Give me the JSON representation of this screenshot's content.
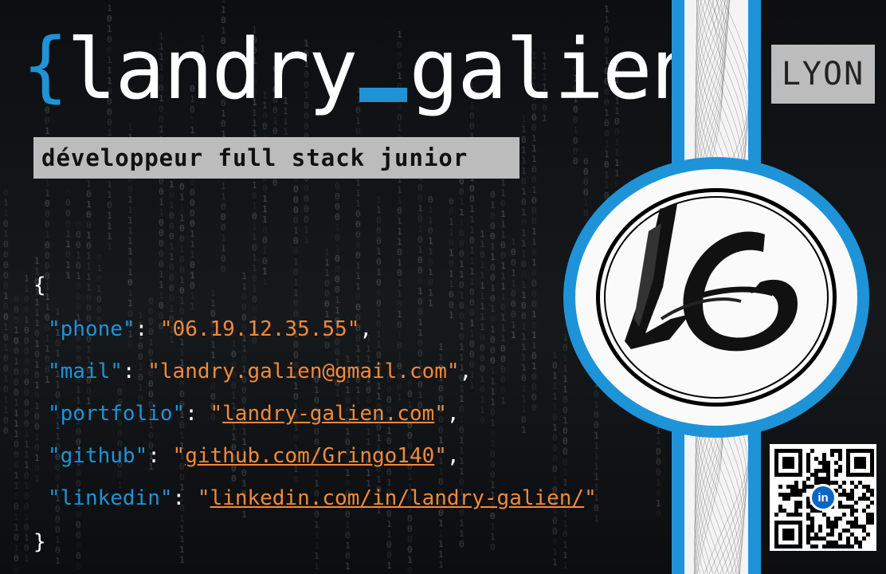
{
  "header": {
    "brace_open": "{",
    "name_first": "landry",
    "name_last": "galien",
    "brace_close": "}"
  },
  "role": "développeur full stack junior",
  "city": "LYON",
  "code": {
    "open": "{",
    "close": "}",
    "entries": [
      {
        "key": "\"phone\"",
        "value": "\"06.19.12.35.55\"",
        "link": false
      },
      {
        "key": "\"mail\"",
        "value": "\"landry.galien@gmail.com\"",
        "link": false
      },
      {
        "key": "\"portfolio\"",
        "value": "landry-galien.com",
        "link": true
      },
      {
        "key": "\"github\"",
        "value": "github.com/Gringo140",
        "link": true
      },
      {
        "key": "\"linkedin\"",
        "value": "linkedin.com/in/landry-galien/",
        "link": true
      }
    ]
  },
  "logo": {
    "monogram": "LG"
  },
  "qr": {
    "badge": "in"
  },
  "colors": {
    "accent": "#1e93d8",
    "value": "#f08a3a",
    "label_bg": "#bcbcbc"
  }
}
